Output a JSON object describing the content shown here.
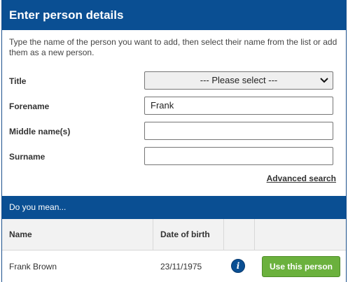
{
  "header": {
    "title": "Enter person details"
  },
  "intro": {
    "text": "Type the name of the person you want to add, then select their name from the list or add them as a new person."
  },
  "form": {
    "title_label": "Title",
    "title_value": "--- Please select ---",
    "forename_label": "Forename",
    "forename_value": "Frank",
    "middle_label": "Middle name(s)",
    "middle_value": "",
    "surname_label": "Surname",
    "surname_value": "",
    "advanced_search": "Advanced search"
  },
  "suggestions": {
    "heading": "Do you mean...",
    "columns": {
      "name": "Name",
      "dob": "Date of birth"
    },
    "rows": [
      {
        "name": "Frank Brown",
        "dob": "23/11/1975",
        "info_icon": "i",
        "action": "Use this person"
      }
    ]
  },
  "colors": {
    "primary": "#0a4f93",
    "action_green": "#6bb13d"
  },
  "icons": {
    "info": "info-icon",
    "dropdown": "chevron-down-icon"
  }
}
